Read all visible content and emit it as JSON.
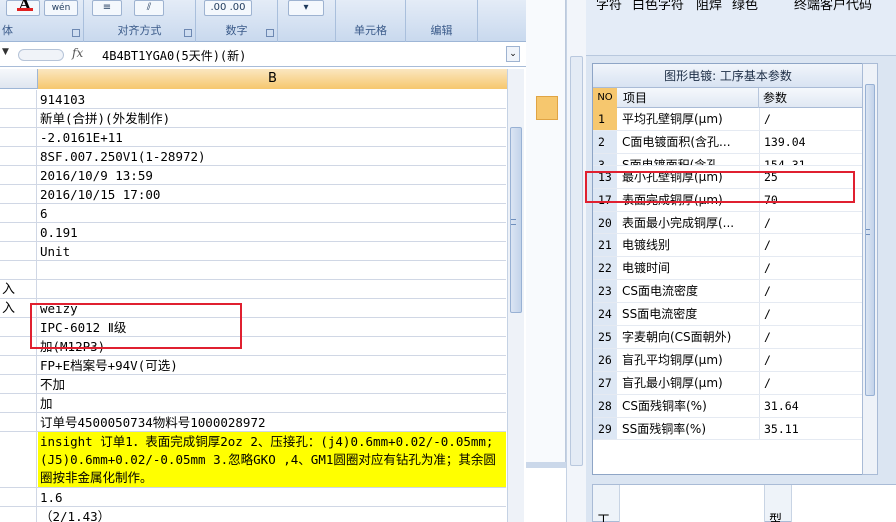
{
  "ribbon": {
    "font_group_label": "体",
    "font_color_glyph": "A",
    "wen_glyph": "wén",
    "wen_char": "文",
    "align_label": "对齐方式",
    "number_label": "数字",
    "number_format_text": ".00 .00",
    "cells_label": "单元格",
    "edit_label": "编辑"
  },
  "formula_bar": {
    "fx": "fx",
    "content": "4B4BT1YGA0(5天件)(新)"
  },
  "column_header": "B",
  "rows": [
    {
      "a": "",
      "b": "914103"
    },
    {
      "a": "",
      "b": "新单(合拼)(外发制作)"
    },
    {
      "a": "",
      "b": "-2.0161E+11"
    },
    {
      "a": "",
      "b": "8SF.007.250V1(1-28972)"
    },
    {
      "a": "",
      "b": "2016/10/9 13:59"
    },
    {
      "a": "",
      "b": "2016/10/15 17:00"
    },
    {
      "a": "",
      "b": "6"
    },
    {
      "a": "",
      "b": "0.191"
    },
    {
      "a": "",
      "b": "Unit"
    },
    {
      "a": "",
      "b": ""
    },
    {
      "a": "入",
      "b": ""
    },
    {
      "a": "入",
      "b": "weizy"
    },
    {
      "a": "",
      "b": "IPC-6012 Ⅱ级"
    },
    {
      "a": "",
      "b": "加(M12P3)"
    },
    {
      "a": "",
      "b": "FP+E档案号+94V(可选)"
    },
    {
      "a": "",
      "b": "不加"
    },
    {
      "a": "",
      "b": "加"
    },
    {
      "a": "",
      "b": "订单号4500050734物料号1000028972"
    }
  ],
  "yellow_row": "insight 订单1．表面完成铜厚2oz  2、压接孔：(j4)0.6mm+0.02/-0.05mm;(J5)0.6mm+0.02/-0.05mm  3.忽略GKO ,4、GM1圆圈对应有钻孔为准；其余圆圈按非金属化制作。",
  "rows_after": [
    {
      "a": "",
      "b": "1.6"
    },
    {
      "a": "",
      "b": "（2/1.43）"
    }
  ],
  "top_panel": {
    "label1": "字符",
    "value1": "白色字符",
    "label2": "阻焊",
    "value2": "绿色",
    "label3": "终端客户代码"
  },
  "param_grid": {
    "title": "图形电镀: 工序基本参数",
    "headers": {
      "no": "NO",
      "item": "项目",
      "param": "参数"
    },
    "rows": [
      {
        "no": "1",
        "item": "平均孔壁铜厚(μm)",
        "param": "/"
      },
      {
        "no": "2",
        "item": "C面电镀面积(含孔...",
        "param": "139.04"
      },
      {
        "no": "3",
        "item": "S面电镀面积(含孔",
        "param": "154.31"
      },
      {
        "no": "13",
        "item": "最小孔壁铜厚(μm)",
        "param": "25"
      },
      {
        "no": "17",
        "item": "表面完成铜厚(μm)",
        "param": "70"
      },
      {
        "no": "20",
        "item": "表面最小完成铜厚(...",
        "param": "/"
      },
      {
        "no": "21",
        "item": "电镀线别",
        "param": "/"
      },
      {
        "no": "22",
        "item": "电镀时间",
        "param": "/"
      },
      {
        "no": "23",
        "item": "CS面电流密度",
        "param": "/"
      },
      {
        "no": "24",
        "item": "SS面电流密度",
        "param": "/"
      },
      {
        "no": "25",
        "item": "字麦朝向(CS面朝外)",
        "param": "/"
      },
      {
        "no": "26",
        "item": "盲孔平均铜厚(μm)",
        "param": "/"
      },
      {
        "no": "27",
        "item": "盲孔最小铜厚(μm)",
        "param": "/"
      },
      {
        "no": "28",
        "item": "CS面残铜率(%)",
        "param": "31.64"
      },
      {
        "no": "29",
        "item": "SS面残铜率(%)",
        "param": "35.11"
      }
    ]
  },
  "bottom_panel": {
    "t1": "工",
    "t2": "型"
  }
}
